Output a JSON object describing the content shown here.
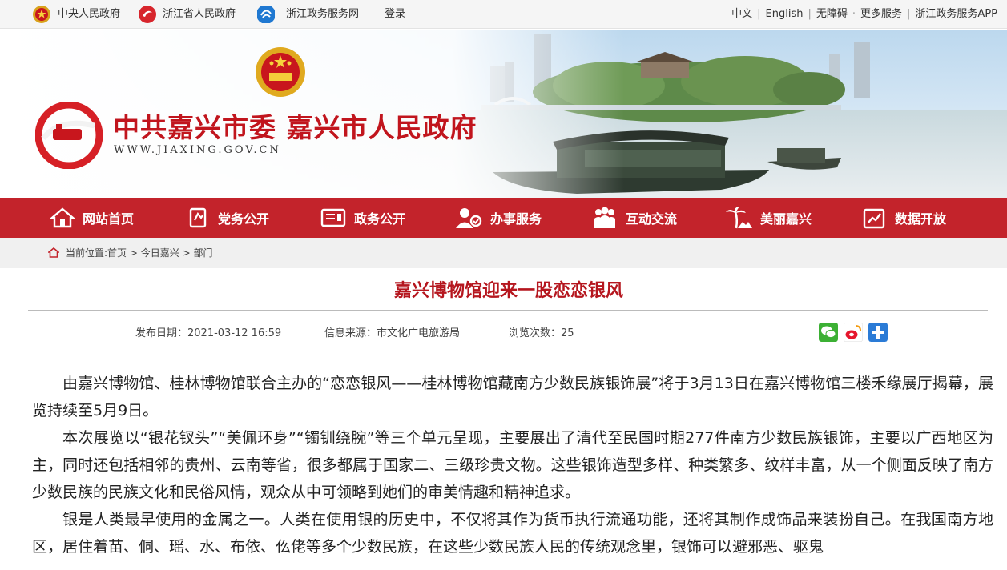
{
  "topbar": {
    "links": [
      {
        "label": "中央人民政府",
        "icon": "national-emblem-icon"
      },
      {
        "label": "浙江省人民政府",
        "icon": "zhejiang-gov-icon"
      },
      {
        "label": "浙江政务服务网",
        "icon": "zhejiang-service-icon"
      },
      {
        "label": "登录"
      }
    ],
    "right": [
      "中文",
      "English",
      "无障碍",
      "更多服务",
      "浙江政务服务APP"
    ]
  },
  "banner": {
    "title": "中共嘉兴市委 嘉兴市人民政府",
    "url": "WWW.JIAXING.GOV.CN"
  },
  "nav": {
    "items": [
      {
        "label": "网站首页",
        "icon": "home-icon"
      },
      {
        "label": "党务公开",
        "icon": "party-icon"
      },
      {
        "label": "政务公开",
        "icon": "document-icon"
      },
      {
        "label": "办事服务",
        "icon": "service-user-icon"
      },
      {
        "label": "互动交流",
        "icon": "people-icon"
      },
      {
        "label": "美丽嘉兴",
        "icon": "palm-icon"
      },
      {
        "label": "数据开放",
        "icon": "data-icon"
      }
    ]
  },
  "breadcrumb": {
    "prefix": "当前位置:",
    "items": [
      "首页",
      "今日嘉兴",
      "部门"
    ],
    "separator": " > "
  },
  "article": {
    "title": "嘉兴博物馆迎来一股恋恋银风",
    "date": "发布日期：2021-03-12 16:59",
    "source": "信息来源：市文化广电旅游局",
    "views": "浏览次数：25",
    "share": [
      "wechat-icon",
      "weibo-icon",
      "plus-share-icon"
    ],
    "paragraphs": [
      "由嘉兴博物馆、桂林博物馆联合主办的“恋恋银风——桂林博物馆藏南方少数民族银饰展”将于3月13日在嘉兴博物馆三楼禾缘展厅揭幕，展览持续至5月9日。",
      "本次展览以“银花钗头”“美佩环身”“镯钏绕腕”等三个单元呈现，主要展出了清代至民国时期277件南方少数民族银饰，主要以广西地区为主，同时还包括相邻的贵州、云南等省，很多都属于国家二、三级珍贵文物。这些银饰造型多样、种类繁多、纹样丰富，从一个侧面反映了南方少数民族的民族文化和民俗风情，观众从中可领略到她们的审美情趣和精神追求。",
      "银是人类最早使用的金属之一。人类在使用银的历史中，不仅将其作为货币执行流通功能，还将其制作成饰品来装扮自己。在我国南方地区，居住着苗、侗、瑶、水、布依、仫佬等多个少数民族，在这些少数民族人民的传统观念里，银饰可以避邪恶、驱鬼"
    ]
  },
  "colors": {
    "brand_red": "#c3232b",
    "title_red": "#b5161e"
  }
}
